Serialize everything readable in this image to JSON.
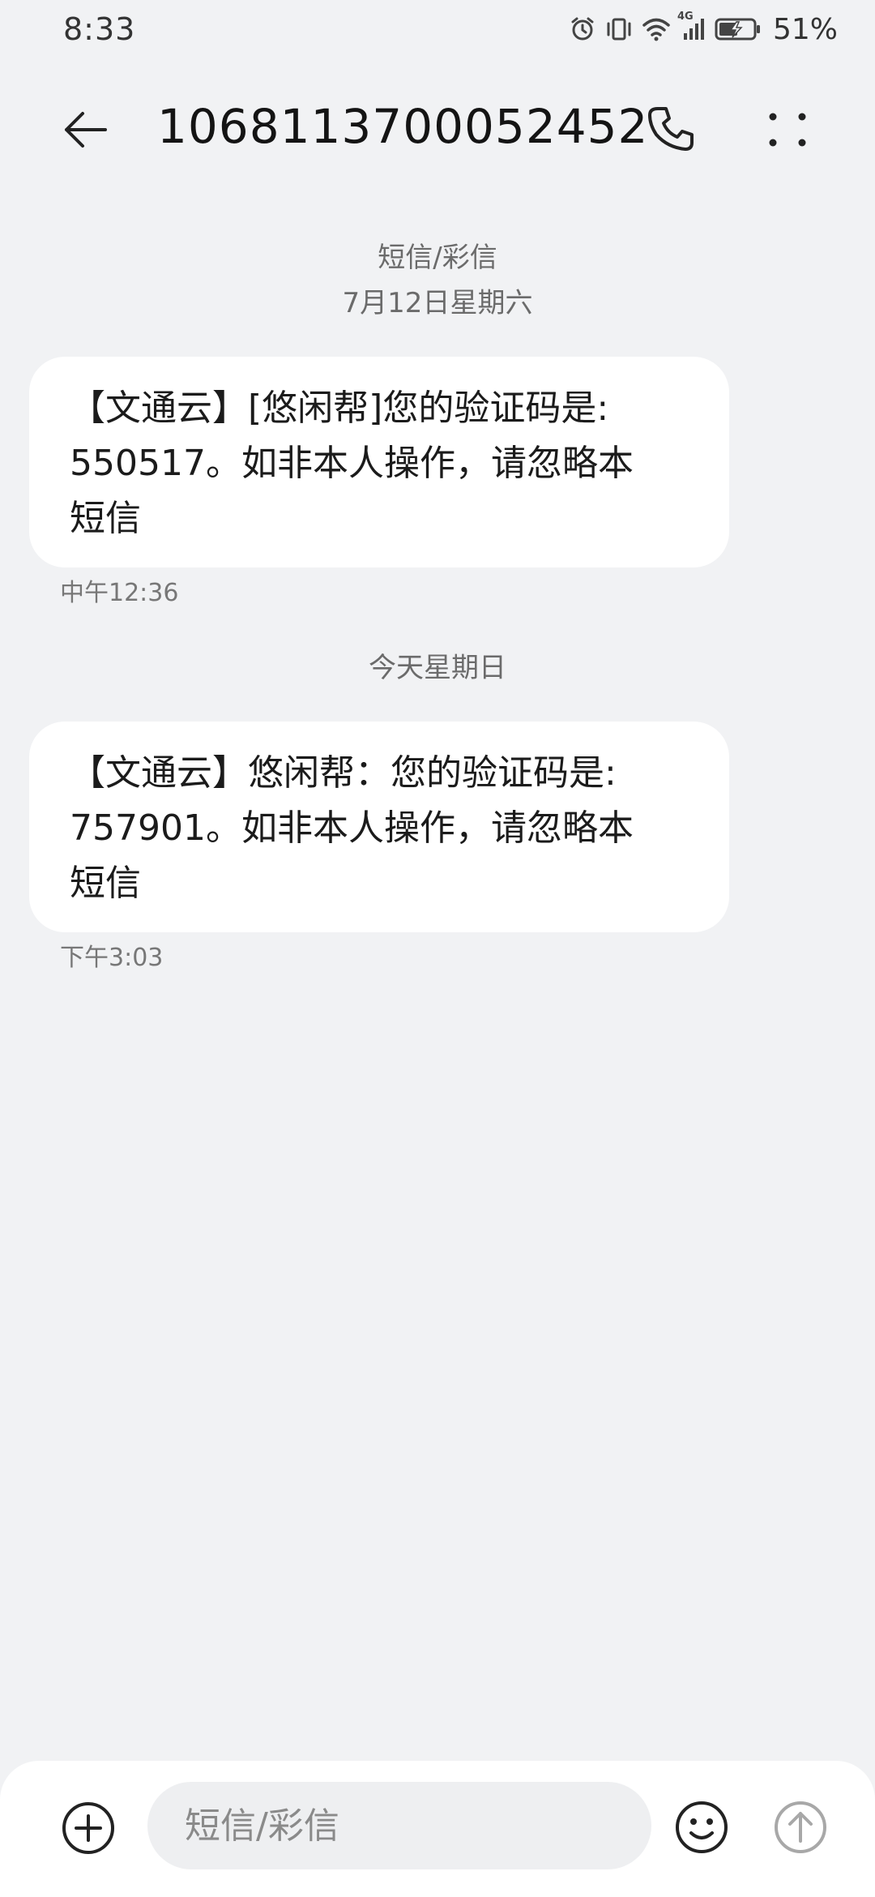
{
  "status_bar": {
    "time": "8:33",
    "network": "4G",
    "battery_percent": "51%",
    "icons": [
      "alarm-icon",
      "vibrate-icon",
      "wifi-icon",
      "signal-icon",
      "battery-charging-icon"
    ]
  },
  "header": {
    "contact_number": "1068113700052452",
    "icons": [
      "back-arrow-icon",
      "phone-icon",
      "more-dots-icon"
    ]
  },
  "conversation": {
    "groups": [
      {
        "type_label": "短信/彩信",
        "date_label": "7月12日星期六",
        "message": {
          "line1": "【文通云】[悠闲帮]您的验证码是:",
          "line2": "550517。如非本人操作，请忽略本",
          "line3": "短信",
          "time": "中午12:36"
        }
      },
      {
        "date_label": "今天星期日",
        "message": {
          "line1": "【文通云】悠闲帮：您的验证码是:",
          "line2": "757901。如非本人操作，请忽略本",
          "line3": "短信",
          "time": "下午3:03"
        }
      }
    ]
  },
  "compose": {
    "placeholder": "短信/彩信",
    "icons": [
      "add-circle-icon",
      "emoji-icon",
      "send-arrow-icon"
    ]
  },
  "colors": {
    "background": "#f1f2f4",
    "bubble": "#ffffff",
    "text": "#1b1b1b",
    "secondary_text": "#6b6b6b",
    "send_disabled": "#a8a8a8"
  }
}
